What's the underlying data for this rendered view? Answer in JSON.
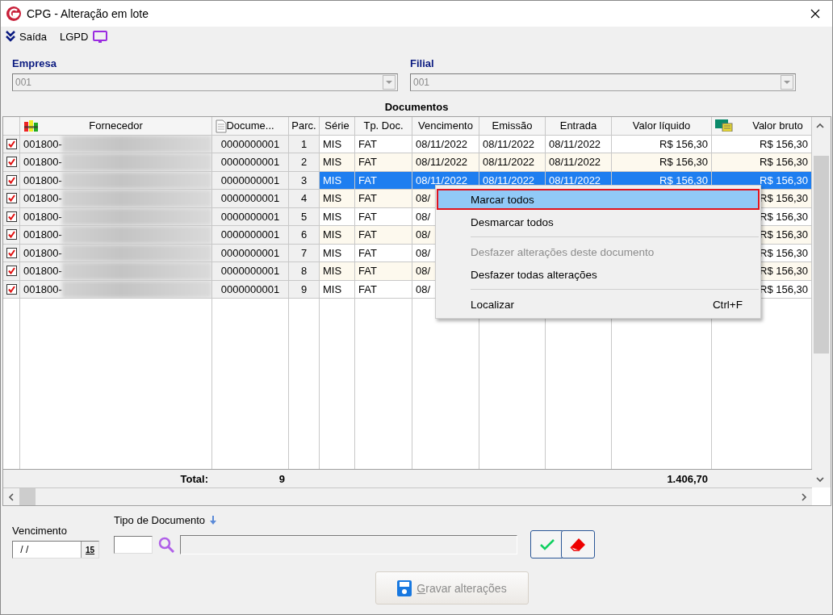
{
  "window": {
    "title": "CPG - Alteração em lote"
  },
  "toolbar": {
    "exit_button": "Saída",
    "lgpd_button": "LGPD"
  },
  "empresa": {
    "label": "Empresa",
    "value": "001",
    "disabled": true
  },
  "filial": {
    "label": "Filial",
    "value": "001",
    "disabled": true
  },
  "grid": {
    "title": "Documentos",
    "columns": [
      "Fornecedor",
      "Docume...",
      "Parc.",
      "Série",
      "Tp. Doc.",
      "Vencimento",
      "Emissão",
      "Entrada",
      "Valor líquido",
      "Valor bruto"
    ],
    "rows": [
      {
        "checked": true,
        "selected": false,
        "fornecedor": "001800-",
        "documento": "0000000001",
        "parcela": "1",
        "serie": "MIS",
        "tipo": "FAT",
        "vencimento": "08/11/2022",
        "emissao": "08/11/2022",
        "entrada": "08/11/2022",
        "valor_liquido": "R$ 156,30",
        "valor_bruto": "R$ 156,30"
      },
      {
        "checked": true,
        "selected": false,
        "fornecedor": "001800-",
        "documento": "0000000001",
        "parcela": "2",
        "serie": "MIS",
        "tipo": "FAT",
        "vencimento": "08/11/2022",
        "emissao": "08/11/2022",
        "entrada": "08/11/2022",
        "valor_liquido": "R$ 156,30",
        "valor_bruto": "R$ 156,30"
      },
      {
        "checked": true,
        "selected": true,
        "fornecedor": "001800-",
        "documento": "0000000001",
        "parcela": "3",
        "serie": "MIS",
        "tipo": "FAT",
        "vencimento": "08/11/2022",
        "emissao": "08/11/2022",
        "entrada": "08/11/2022",
        "valor_liquido": "R$ 156,30",
        "valor_bruto": "R$ 156,30"
      },
      {
        "checked": true,
        "selected": false,
        "fornecedor": "001800-",
        "documento": "0000000001",
        "parcela": "4",
        "serie": "MIS",
        "tipo": "FAT",
        "vencimento": "08/",
        "valor_bruto": "R$ 156,30"
      },
      {
        "checked": true,
        "selected": false,
        "fornecedor": "001800-",
        "documento": "0000000001",
        "parcela": "5",
        "serie": "MIS",
        "tipo": "FAT",
        "vencimento": "08/",
        "valor_bruto": "R$ 156,30"
      },
      {
        "checked": true,
        "selected": false,
        "fornecedor": "001800-",
        "documento": "0000000001",
        "parcela": "6",
        "serie": "MIS",
        "tipo": "FAT",
        "vencimento": "08/",
        "valor_bruto": "R$ 156,30"
      },
      {
        "checked": true,
        "selected": false,
        "fornecedor": "001800-",
        "documento": "0000000001",
        "parcela": "7",
        "serie": "MIS",
        "tipo": "FAT",
        "vencimento": "08/",
        "valor_bruto": "R$ 156,30"
      },
      {
        "checked": true,
        "selected": false,
        "fornecedor": "001800-",
        "documento": "0000000001",
        "parcela": "8",
        "serie": "MIS",
        "tipo": "FAT",
        "vencimento": "08/",
        "valor_bruto": "R$ 156,30"
      },
      {
        "checked": true,
        "selected": false,
        "fornecedor": "001800-",
        "documento": "0000000001",
        "parcela": "9",
        "serie": "MIS",
        "tipo": "FAT",
        "vencimento": "08/",
        "valor_bruto": "R$ 156,30"
      }
    ],
    "totals": {
      "label": "Total:",
      "count": "9",
      "valor_liquido": "1.406,70"
    }
  },
  "context_menu": [
    {
      "kind": "item",
      "label": "Marcar todos",
      "selected": true,
      "disabled": false
    },
    {
      "kind": "item",
      "label": "Desmarcar todos",
      "selected": false,
      "disabled": false
    },
    {
      "kind": "separator"
    },
    {
      "kind": "item",
      "label": "Desfazer alterações deste documento",
      "selected": false,
      "disabled": true
    },
    {
      "kind": "item",
      "label": "Desfazer todas alterações",
      "selected": false,
      "disabled": false
    },
    {
      "kind": "separator"
    },
    {
      "kind": "item",
      "label": "Localizar",
      "shortcut": "Ctrl+F",
      "selected": false,
      "disabled": false
    }
  ],
  "form": {
    "vencimento": {
      "label": "Vencimento",
      "value": " / /",
      "calendar": "15"
    },
    "tipo_documento": {
      "label": "Tipo de Documento"
    }
  },
  "save_button": {
    "label": "Gravar alterações",
    "disabled": true
  }
}
